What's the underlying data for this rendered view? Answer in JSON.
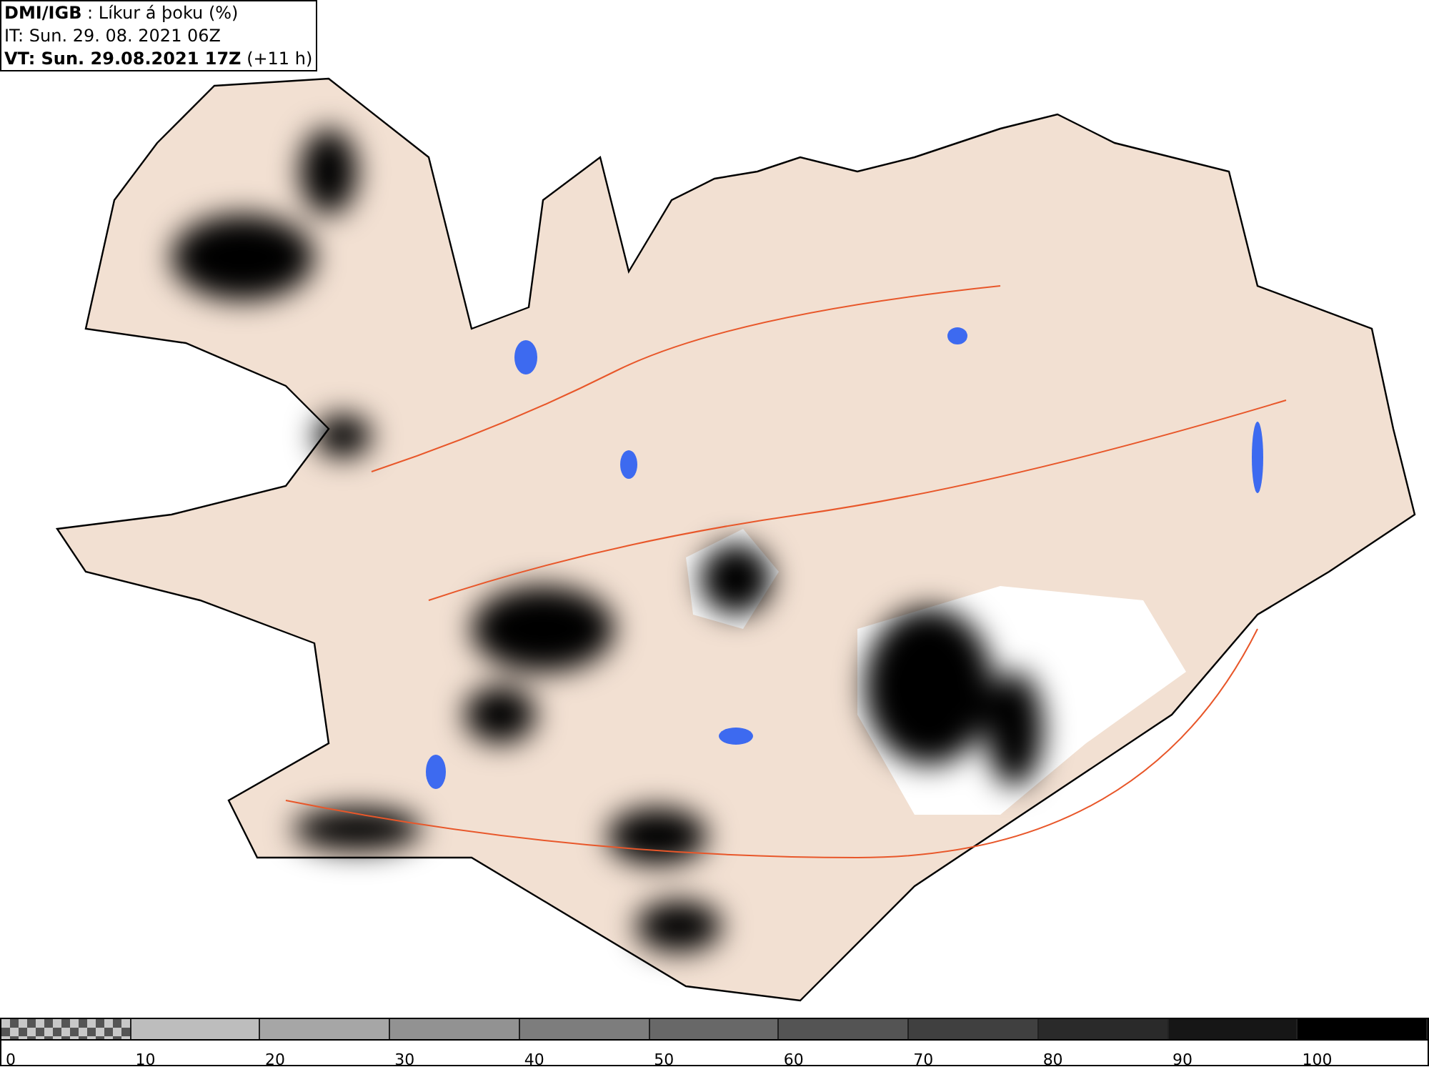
{
  "header": {
    "title": "**DMI/IGB** : Líkur á þoku (%)",
    "issue_time": "IT: Sun. 29. 08. 2021 06Z",
    "valid_time": "**VT: Sun. 29.08.2021 17Z** (+11 h)"
  },
  "legend": [
    {
      "label": "0",
      "color": "#c8c8c8",
      "kind": "checker"
    },
    {
      "label": "10",
      "color": "#bdbdbd",
      "kind": "solid"
    },
    {
      "label": "20",
      "color": "#a6a6a6",
      "kind": "solid"
    },
    {
      "label": "30",
      "color": "#929292",
      "kind": "solid"
    },
    {
      "label": "40",
      "color": "#7d7d7d",
      "kind": "solid"
    },
    {
      "label": "50",
      "color": "#686868",
      "kind": "solid"
    },
    {
      "label": "60",
      "color": "#545454",
      "kind": "solid"
    },
    {
      "label": "70",
      "color": "#404040",
      "kind": "solid"
    },
    {
      "label": "80",
      "color": "#2a2a2a",
      "kind": "solid"
    },
    {
      "label": "90",
      "color": "#161616",
      "kind": "solid"
    },
    {
      "label": "100",
      "color": "#000000",
      "kind": "solid"
    }
  ]
}
